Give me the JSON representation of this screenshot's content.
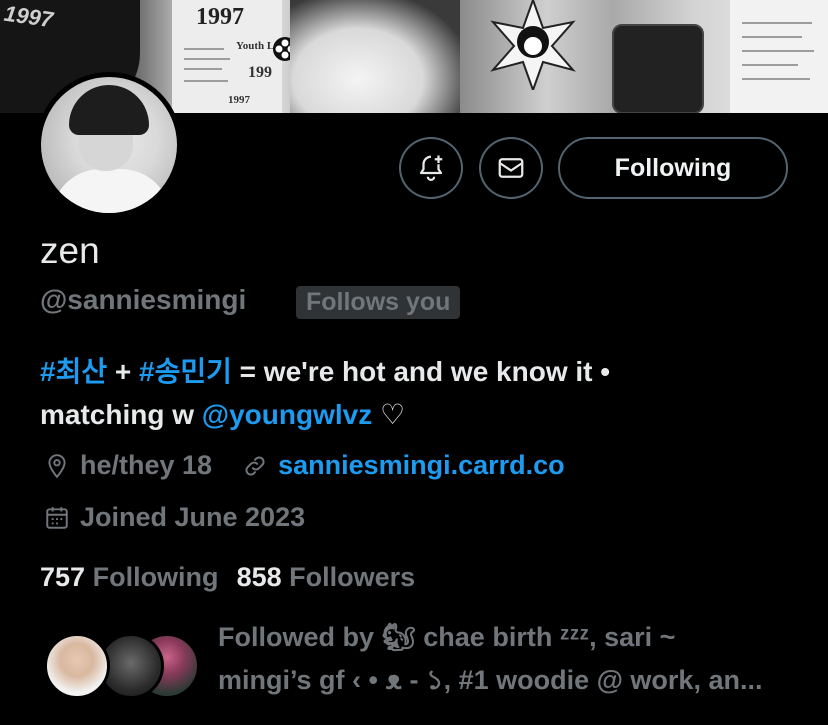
{
  "banner": {
    "jacket_text": "1997",
    "paper_year": "1997",
    "paper_lines": [
      "199",
      "1997",
      "Youth Le"
    ]
  },
  "profile": {
    "name": "zen",
    "handle": "@sanniesmingi",
    "follows_you_badge": "Follows you"
  },
  "actions": {
    "notify_icon": "bell-plus-icon",
    "message_icon": "envelope-icon",
    "follow_label": "Following"
  },
  "bio": {
    "tag1": "#최산",
    "plus": " + ",
    "tag2": "#송민기",
    "rest1": " = we're hot and we know it •",
    "matching": "matching w ",
    "mention": "@youngwlvz",
    "heart": " ♡"
  },
  "meta": {
    "location": "he/they 18",
    "website": "sanniesmingi.carrd.co",
    "joined": "Joined June 2023"
  },
  "counts": {
    "following_num": "757",
    "following_label": "Following",
    "followers_num": "858",
    "followers_label": "Followers"
  },
  "followed_by": {
    "line1": "Followed by 🐿 chae birth ᶻᶻᶻ, sari ~",
    "line2": "mingi’s gf ‹ • ᴥ - ১, #1 woodie @ work, an..."
  },
  "colors": {
    "background": "#000000",
    "text": "#e7e9ea",
    "muted": "#71767b",
    "link": "#1d9bf0",
    "border": "#536471"
  }
}
